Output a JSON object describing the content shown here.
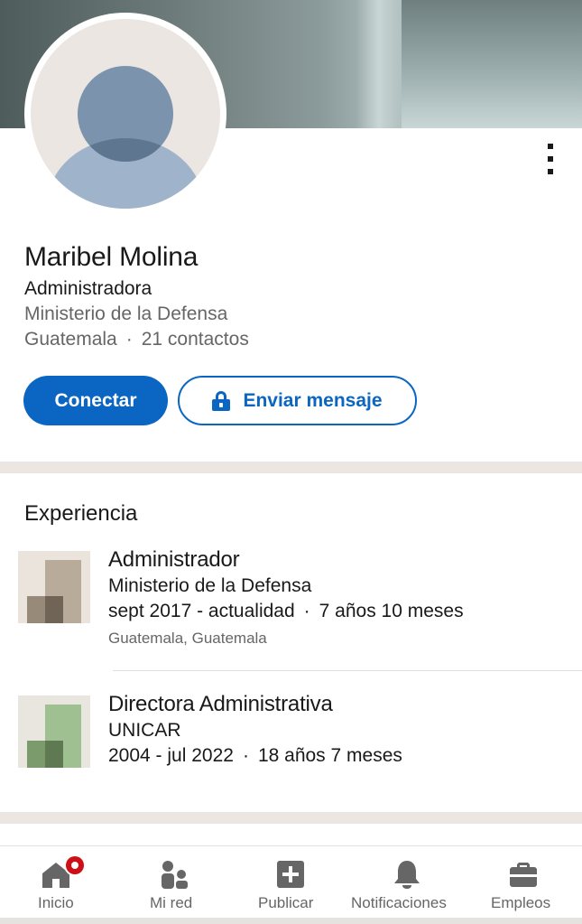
{
  "profile": {
    "name": "Maribel Molina",
    "headline": "Administradora",
    "company": "Ministerio de la Defensa",
    "location": "Guatemala",
    "separator": "·",
    "connections": "21 contactos"
  },
  "actions": {
    "connect_label": "Conectar",
    "message_label": "Enviar mensaje"
  },
  "experience": {
    "title": "Experiencia",
    "items": [
      {
        "title": "Administrador",
        "company": "Ministerio de la Defensa",
        "dates": "sept 2017 - actualidad",
        "duration": "7 años 10 meses",
        "location": "Guatemala, Guatemala"
      },
      {
        "title": "Directora Administrativa",
        "company": "UNICAR",
        "dates": "2004 - jul 2022",
        "duration": "18 años 7 meses"
      }
    ]
  },
  "nav": {
    "items": [
      {
        "label": "Inicio",
        "icon": "home-icon",
        "badge": true
      },
      {
        "label": "Mi red",
        "icon": "network-icon"
      },
      {
        "label": "Publicar",
        "icon": "post-icon"
      },
      {
        "label": "Notificaciones",
        "icon": "bell-icon"
      },
      {
        "label": "Empleos",
        "icon": "briefcase-icon"
      }
    ]
  },
  "colors": {
    "accent": "#0a66c2",
    "badge": "#cc1016",
    "divider": "#ebe6e1"
  }
}
